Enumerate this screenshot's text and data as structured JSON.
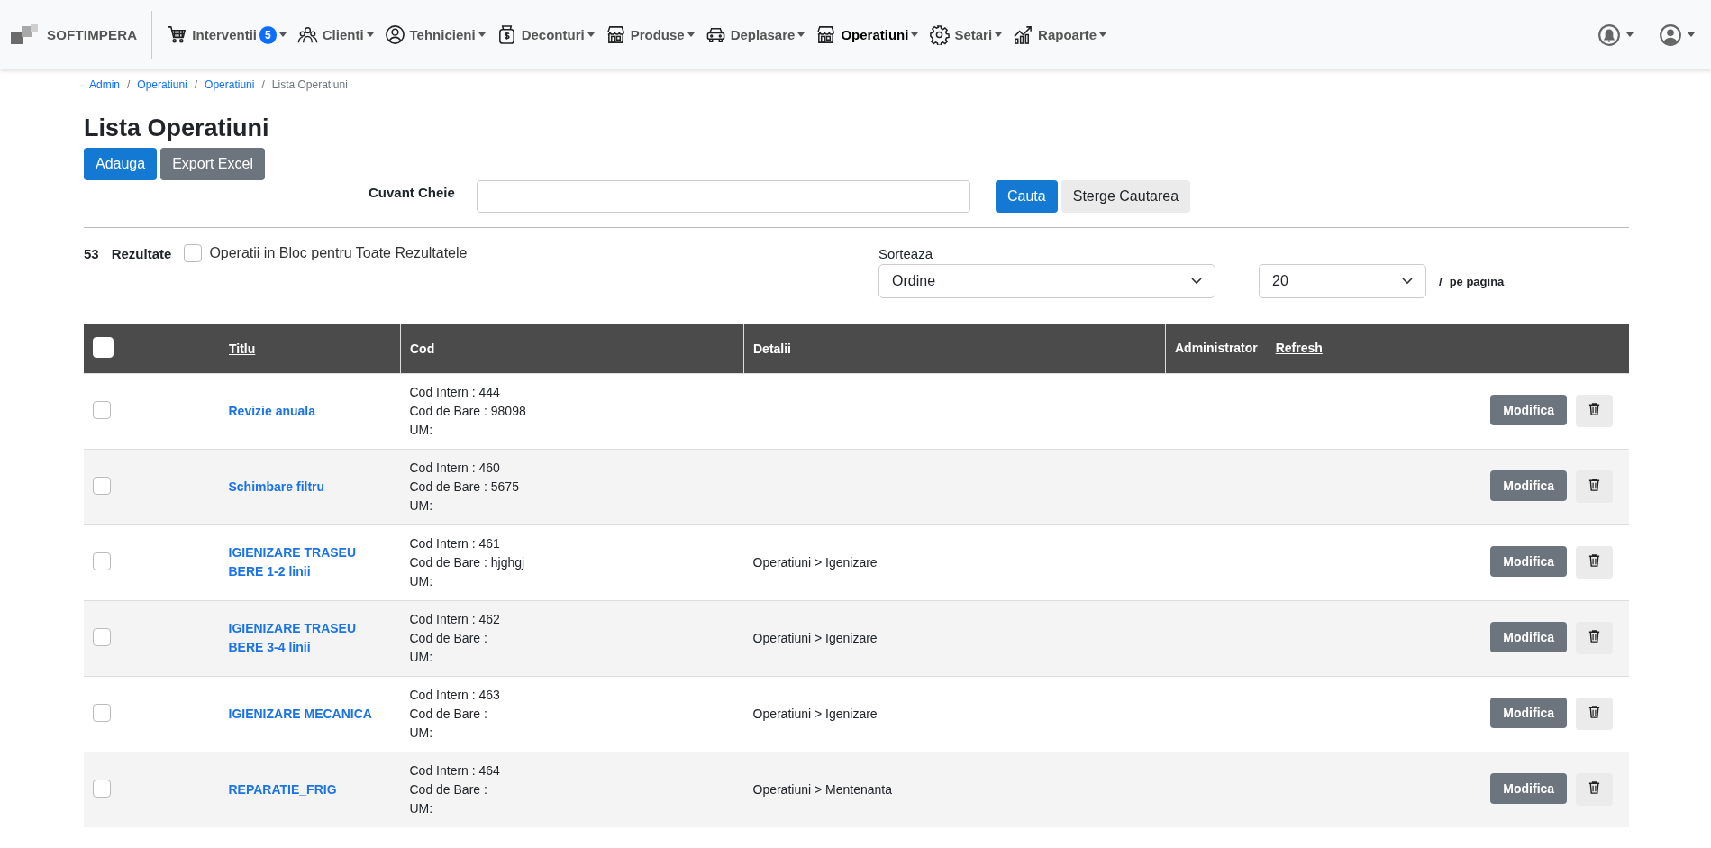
{
  "brand": {
    "name": "SOFTIMPERA"
  },
  "nav": [
    {
      "label": "Interventii",
      "kind": "cart",
      "badge": "5",
      "selected": false
    },
    {
      "label": "Clienti",
      "kind": "people",
      "selected": false
    },
    {
      "label": "Tehnicieni",
      "kind": "person",
      "selected": false
    },
    {
      "label": "Deconturi",
      "kind": "money",
      "selected": false
    },
    {
      "label": "Produse",
      "kind": "shop",
      "selected": false
    },
    {
      "label": "Deplasare",
      "kind": "car",
      "selected": false
    },
    {
      "label": "Operatiuni",
      "kind": "shop",
      "selected": true
    },
    {
      "label": "Setari",
      "kind": "gear",
      "selected": false
    },
    {
      "label": "Rapoarte",
      "kind": "chart",
      "selected": false
    }
  ],
  "breadcrumb": [
    {
      "label": "Admin",
      "link": true,
      "separator": "/"
    },
    {
      "label": "Operatiuni",
      "link": true,
      "separator": "/"
    },
    {
      "label": "Operatiuni",
      "link": true,
      "separator": "/"
    },
    {
      "label": "Lista Operatiuni",
      "link": false
    }
  ],
  "title": "Lista Operatiuni",
  "actions": [
    "Adauga",
    "Export Excel"
  ],
  "search": {
    "label": "Cuvant Cheie",
    "submit": "Cauta",
    "clear": "Sterge Cautarea"
  },
  "results": {
    "count": "53",
    "label": "Rezultate",
    "bulk": {
      "label": "Operatii in Bloc pentru Toate Rezultatele",
      "checked": false
    }
  },
  "sort": {
    "label": "Sorteaza",
    "value": "Ordine",
    "per_page_value": "20",
    "separator": "/",
    "per_page_label": "pe pagina"
  },
  "table": {
    "select_all_checked": false,
    "columns": [
      {
        "label": "Titlu",
        "link": true
      },
      {
        "label": "Cod",
        "link": false
      },
      {
        "label": "Detalii",
        "link": false
      },
      {
        "label": "Administrator",
        "link": false
      }
    ],
    "refresh": "Refresh",
    "rows": [
      {
        "checked": false,
        "title": "Revizie anuala",
        "cod": [
          "Cod Intern : 444",
          "Cod de Bare : 98098",
          "UM:"
        ],
        "edit": "Modifica"
      },
      {
        "checked": false,
        "title": "Schimbare filtru",
        "cod": [
          "Cod Intern : 460",
          "Cod de Bare : 5675",
          "UM:"
        ],
        "edit": "Modifica"
      },
      {
        "checked": false,
        "title": "IGIENIZARE TRASEU BERE 1-2 linii",
        "cod": [
          "Cod Intern : 461",
          "Cod de Bare : hjghgj",
          "UM:"
        ],
        "details": "Operatiuni > Igenizare",
        "edit": "Modifica"
      },
      {
        "checked": false,
        "title": "IGIENIZARE TRASEU BERE 3-4 linii",
        "cod": [
          "Cod Intern : 462",
          "Cod de Bare :",
          "UM:"
        ],
        "details": "Operatiuni > Igenizare",
        "edit": "Modifica"
      },
      {
        "checked": false,
        "title": "IGIENIZARE MECANICA",
        "cod": [
          "Cod Intern : 463",
          "Cod de Bare :",
          "UM:"
        ],
        "details": "Operatiuni > Igenizare",
        "edit": "Modifica"
      },
      {
        "checked": false,
        "title": "REPARATIE_FRIG",
        "cod": [
          "Cod Intern : 464",
          "Cod de Bare :",
          "UM:"
        ],
        "details": "Operatiuni > Mentenanta",
        "edit": "Modifica"
      }
    ]
  }
}
